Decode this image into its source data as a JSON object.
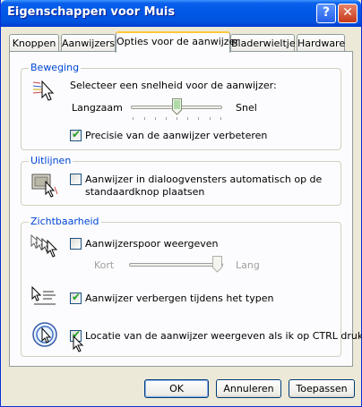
{
  "window": {
    "title": "Eigenschappen voor Muis",
    "help_symbol": "?",
    "close_symbol": "✕"
  },
  "tabs": [
    {
      "label": "Knoppen",
      "active": false
    },
    {
      "label": "Aanwijzers",
      "active": false
    },
    {
      "label": "Opties voor de aanwijzer",
      "active": true
    },
    {
      "label": "Bladerwieltje",
      "active": false
    },
    {
      "label": "Hardware",
      "active": false
    }
  ],
  "motion": {
    "title": "Beweging",
    "speed_label": "Selecteer een snelheid voor de aanwijzer:",
    "slow_label": "Langzaam",
    "fast_label": "Snel",
    "speed_level": 0.5,
    "precision_label": "Precisie van de aanwijzer verbeteren",
    "precision_checked": true
  },
  "snap": {
    "title": "Uitlijnen",
    "snap_label_line1": "Aanwijzer in dialoogvensters automatisch op de",
    "snap_label_line2": "standaardknop plaatsen",
    "snap_checked": false
  },
  "visibility": {
    "title": "Zichtbaarheid",
    "trails_label": "Aanwijzerspoor weergeven",
    "trails_checked": false,
    "short_label": "Kort",
    "long_label": "Lang",
    "trail_level": 1.0,
    "hide_label": "Aanwijzer verbergen tijdens het typen",
    "hide_checked": true,
    "ctrl_label": "Locatie van de aanwijzer weergeven als ik op CTRL druk",
    "ctrl_checked": true
  },
  "buttons": {
    "ok": "OK",
    "cancel": "Annuleren",
    "apply": "Toepassen"
  },
  "icons": [
    "pointer-speed-icon",
    "snap-to-icon",
    "pointer-trails-icon",
    "hide-pointer-icon",
    "ctrl-locate-icon"
  ],
  "colors": {
    "titlebar": "#0058E6",
    "group_title": "#0046D5",
    "check": "#21A121",
    "window_bg": "#ECE9D8"
  }
}
